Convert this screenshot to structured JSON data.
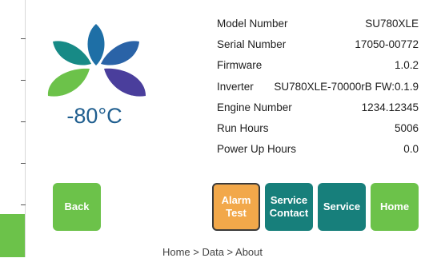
{
  "status": {
    "temperature": "-80°C"
  },
  "specs": [
    {
      "label": "Model Number",
      "value": "SU780XLE"
    },
    {
      "label": "Serial Number",
      "value": "17050-00772"
    },
    {
      "label": "Firmware",
      "value": "1.0.2"
    },
    {
      "label": "Inverter",
      "value": "SU780XLE-70000rB FW:0.1.9"
    },
    {
      "label": "Engine Number",
      "value": "1234.12345"
    },
    {
      "label": "Run Hours",
      "value": "5006"
    },
    {
      "label": "Power Up Hours",
      "value": "0.0"
    }
  ],
  "buttons": {
    "back": "Back",
    "alarm_test": "Alarm Test",
    "service_contact": "Service Contact",
    "service": "Service",
    "home": "Home"
  },
  "breadcrumb": "Home > Data > About",
  "colors": {
    "green": "#6cc24a",
    "teal": "#177f7b",
    "orange": "#f2a84a",
    "temperature_blue": "#1f5e8f"
  }
}
